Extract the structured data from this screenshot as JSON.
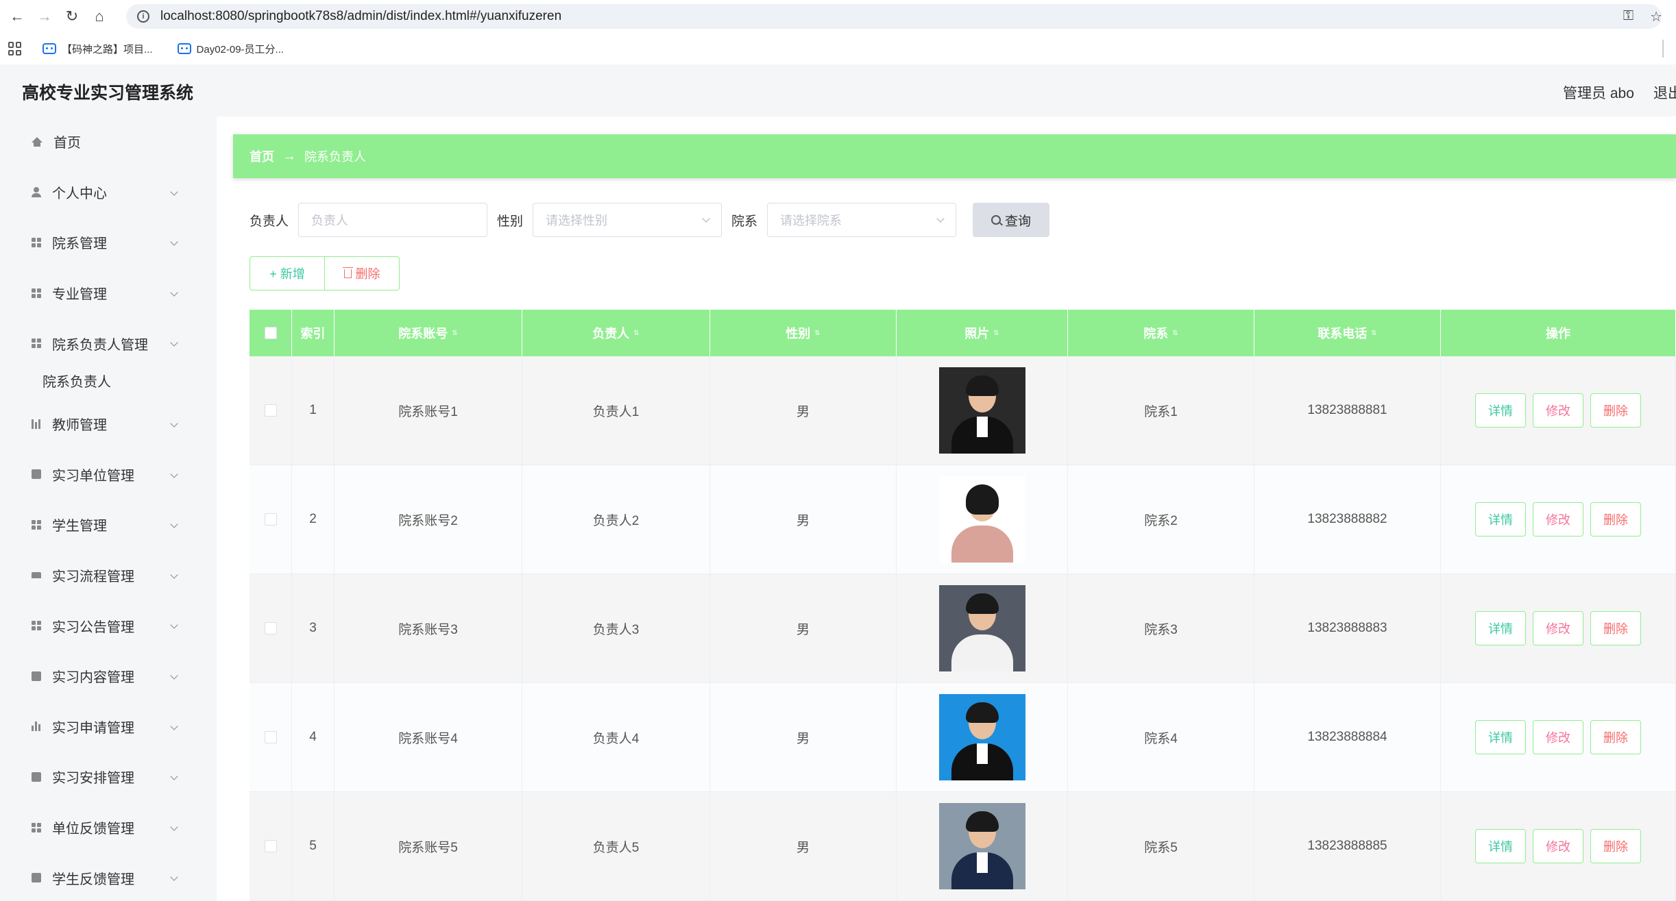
{
  "browser": {
    "url": "localhost:8080/springbootk78s8/admin/dist/index.html#/yuanxifuzeren",
    "bookmarks": [
      "【码神之路】项目...",
      "Day02-09-员工分..."
    ]
  },
  "header": {
    "app_title": "高校专业实习管理系统",
    "admin": "管理员 abo",
    "logout": "退出"
  },
  "sidebar": {
    "items": [
      {
        "label": "首页",
        "icon": "home-icon"
      },
      {
        "label": "个人中心",
        "icon": "person-icon"
      },
      {
        "label": "院系管理",
        "icon": "grid-icon"
      },
      {
        "label": "专业管理",
        "icon": "grid-icon"
      },
      {
        "label": "院系负责人管理",
        "icon": "grid-icon"
      },
      {
        "label": "教师管理",
        "icon": "chart-icon"
      },
      {
        "label": "实习单位管理",
        "icon": "bank-icon"
      },
      {
        "label": "学生管理",
        "icon": "grid-icon"
      },
      {
        "label": "实习流程管理",
        "icon": "pin-icon"
      },
      {
        "label": "实习公告管理",
        "icon": "grid-icon"
      },
      {
        "label": "实习内容管理",
        "icon": "clipboard-icon"
      },
      {
        "label": "实习申请管理",
        "icon": "bar-chart-icon"
      },
      {
        "label": "实习安排管理",
        "icon": "clipboard-icon"
      },
      {
        "label": "单位反馈管理",
        "icon": "grid-icon"
      },
      {
        "label": "学生反馈管理",
        "icon": "send-icon"
      }
    ],
    "submenu": "院系负责人"
  },
  "breadcrumb": {
    "home": "首页",
    "arrow": "→",
    "current": "院系负责人"
  },
  "search": {
    "person_label": "负责人",
    "person_placeholder": "负责人",
    "gender_label": "性别",
    "gender_placeholder": "请选择性别",
    "dept_label": "院系",
    "dept_placeholder": "请选择院系",
    "query_label": "查询"
  },
  "actions": {
    "add_label": "+ 新增",
    "delete_label": "删除"
  },
  "table": {
    "headers": [
      "索引",
      "院系账号",
      "负责人",
      "性别",
      "照片",
      "院系",
      "联系电话",
      "操作"
    ],
    "rows": [
      {
        "index": "1",
        "account": "院系账号1",
        "person": "负责人1",
        "gender": "男",
        "dept": "院系1",
        "phone": "13823888881"
      },
      {
        "index": "2",
        "account": "院系账号2",
        "person": "负责人2",
        "gender": "男",
        "dept": "院系2",
        "phone": "13823888882"
      },
      {
        "index": "3",
        "account": "院系账号3",
        "person": "负责人3",
        "gender": "男",
        "dept": "院系3",
        "phone": "13823888883"
      },
      {
        "index": "4",
        "account": "院系账号4",
        "person": "负责人4",
        "gender": "男",
        "dept": "院系4",
        "phone": "13823888884"
      },
      {
        "index": "5",
        "account": "院系账号5",
        "person": "负责人5",
        "gender": "男",
        "dept": "院系5",
        "phone": "13823888885"
      }
    ],
    "row_actions": {
      "detail": "详情",
      "edit": "修改",
      "delete": "删除"
    }
  },
  "colors": {
    "accent": "#90ee90",
    "detail_text": "#3cc8a0",
    "edit_text": "#f5749a",
    "delete_text": "#f56c6c"
  }
}
